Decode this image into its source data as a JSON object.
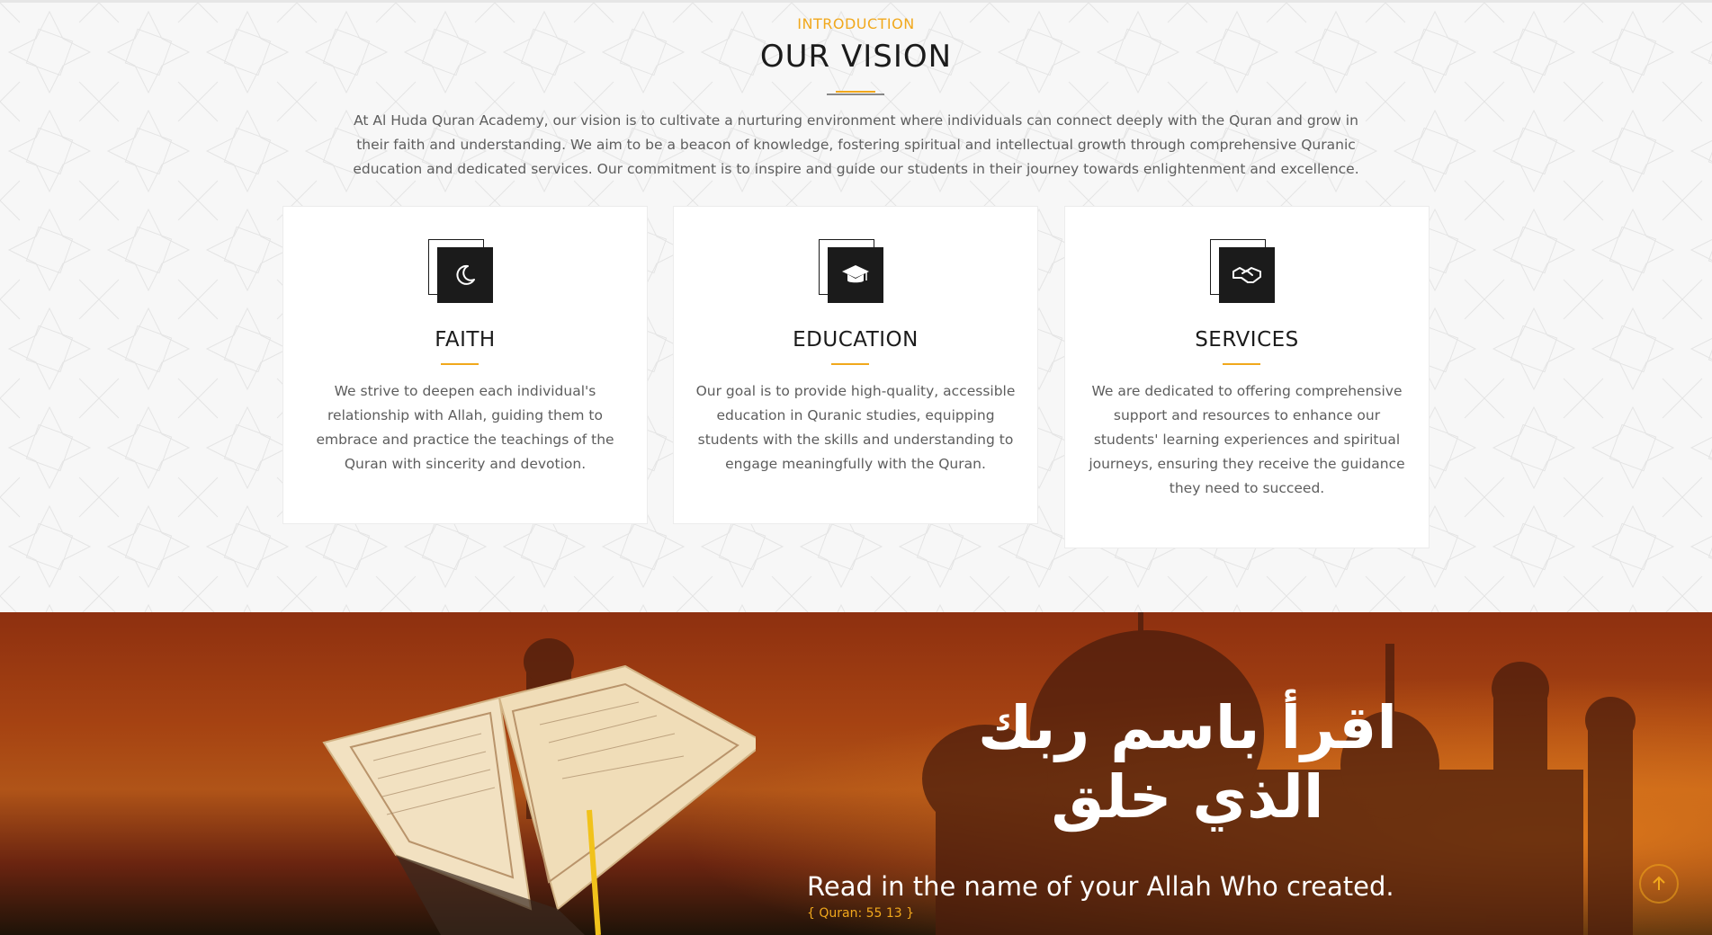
{
  "intro": {
    "eyebrow": "INTRODUCTION",
    "title": "OUR VISION",
    "text": "At Al Huda Quran Academy, our vision is to cultivate a nurturing environment where individuals can connect deeply with the Quran and grow in their faith and understanding. We aim to be a beacon of knowledge, fostering spiritual and intellectual growth through comprehensive Quranic education and dedicated services. Our commitment is to inspire and guide our students in their journey towards enlightenment and excellence."
  },
  "cards": [
    {
      "icon": "crescent-moon-icon",
      "title": "FAITH",
      "text": "We strive to deepen each individual's relationship with Allah, guiding them to embrace and practice the teachings of the Quran with sincerity and devotion."
    },
    {
      "icon": "graduation-cap-icon",
      "title": "EDUCATION",
      "text": "Our goal is to provide high-quality, accessible education in Quranic studies, equipping students with the skills and understanding to engage meaningfully with the Quran."
    },
    {
      "icon": "handshake-icon",
      "title": "SERVICES",
      "text": "We are dedicated to offering comprehensive support and resources to enhance our students' learning experiences and spiritual journeys, ensuring they receive the guidance they need to succeed."
    }
  ],
  "banner": {
    "arabic_calligraphy": "اقرأ باسم ربك الذي خلق",
    "quote": "Read in the name of your Allah Who created.",
    "reference": "{ Quran: 55 13 }"
  },
  "colors": {
    "accent": "#f1a81c",
    "dark": "#1b1b1b",
    "text": "#5d5d5d"
  },
  "scroll_top": {
    "icon": "arrow-up-icon"
  }
}
